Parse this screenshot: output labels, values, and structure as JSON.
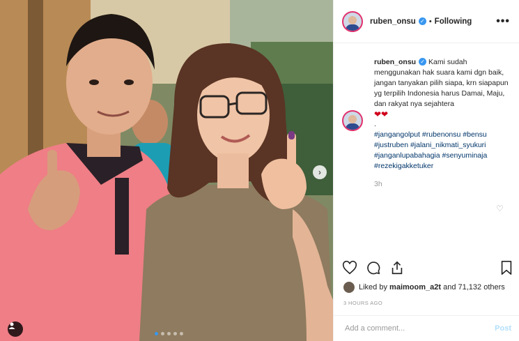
{
  "post": {
    "username": "ruben_onsu",
    "follow_status": "Following",
    "separator": "•",
    "more_label": "•••",
    "caption_text": "Kami sudah menggunakan hak suara kami dgn baik, jangan tanyakan pilih siapa, krn siapapun yg terpilih Indonesia harus Damai, Maju, dan rakyat nya sejahtera",
    "caption_hearts": "❤❤",
    "caption_dot": ".",
    "hashtags": "#jangangolput #rubenonsu #bensu\n#justruben #jalani_nikmati_syukuri\n#janganlupabahagia #senyuminaja\n#rezekigakketuker",
    "time_ago": "3h",
    "liked_by_prefix": "Liked by",
    "liked_by_user": "maimoom_a2t",
    "liked_by_suffix": "and 71,132 others",
    "posted_ago": "3 HOURS AGO"
  },
  "comment": {
    "placeholder": "Add a comment...",
    "post_label": "Post"
  },
  "carousel": {
    "next_arrow": "›",
    "active_index": 0,
    "total": 5
  },
  "icons": [
    "heart-icon",
    "comment-icon",
    "share-icon",
    "bookmark-icon",
    "user-tag-icon",
    "verified-icon",
    "more-options-icon"
  ],
  "colors": {
    "verified_blue": "#3897f0",
    "link_blue": "#003569",
    "muted_gray": "#999999",
    "post_button_disabled": "#b2dffc",
    "heart_red": "#d0021b"
  }
}
